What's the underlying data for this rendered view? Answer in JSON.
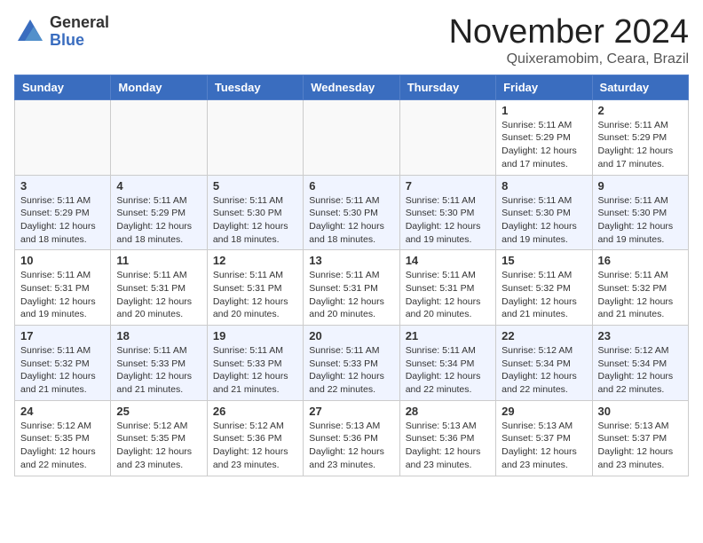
{
  "header": {
    "logo_general": "General",
    "logo_blue": "Blue",
    "month_title": "November 2024",
    "location": "Quixeramobim, Ceara, Brazil"
  },
  "weekdays": [
    "Sunday",
    "Monday",
    "Tuesday",
    "Wednesday",
    "Thursday",
    "Friday",
    "Saturday"
  ],
  "weeks": [
    [
      {
        "day": "",
        "info": ""
      },
      {
        "day": "",
        "info": ""
      },
      {
        "day": "",
        "info": ""
      },
      {
        "day": "",
        "info": ""
      },
      {
        "day": "",
        "info": ""
      },
      {
        "day": "1",
        "info": "Sunrise: 5:11 AM\nSunset: 5:29 PM\nDaylight: 12 hours\nand 17 minutes."
      },
      {
        "day": "2",
        "info": "Sunrise: 5:11 AM\nSunset: 5:29 PM\nDaylight: 12 hours\nand 17 minutes."
      }
    ],
    [
      {
        "day": "3",
        "info": "Sunrise: 5:11 AM\nSunset: 5:29 PM\nDaylight: 12 hours\nand 18 minutes."
      },
      {
        "day": "4",
        "info": "Sunrise: 5:11 AM\nSunset: 5:29 PM\nDaylight: 12 hours\nand 18 minutes."
      },
      {
        "day": "5",
        "info": "Sunrise: 5:11 AM\nSunset: 5:30 PM\nDaylight: 12 hours\nand 18 minutes."
      },
      {
        "day": "6",
        "info": "Sunrise: 5:11 AM\nSunset: 5:30 PM\nDaylight: 12 hours\nand 18 minutes."
      },
      {
        "day": "7",
        "info": "Sunrise: 5:11 AM\nSunset: 5:30 PM\nDaylight: 12 hours\nand 19 minutes."
      },
      {
        "day": "8",
        "info": "Sunrise: 5:11 AM\nSunset: 5:30 PM\nDaylight: 12 hours\nand 19 minutes."
      },
      {
        "day": "9",
        "info": "Sunrise: 5:11 AM\nSunset: 5:30 PM\nDaylight: 12 hours\nand 19 minutes."
      }
    ],
    [
      {
        "day": "10",
        "info": "Sunrise: 5:11 AM\nSunset: 5:31 PM\nDaylight: 12 hours\nand 19 minutes."
      },
      {
        "day": "11",
        "info": "Sunrise: 5:11 AM\nSunset: 5:31 PM\nDaylight: 12 hours\nand 20 minutes."
      },
      {
        "day": "12",
        "info": "Sunrise: 5:11 AM\nSunset: 5:31 PM\nDaylight: 12 hours\nand 20 minutes."
      },
      {
        "day": "13",
        "info": "Sunrise: 5:11 AM\nSunset: 5:31 PM\nDaylight: 12 hours\nand 20 minutes."
      },
      {
        "day": "14",
        "info": "Sunrise: 5:11 AM\nSunset: 5:31 PM\nDaylight: 12 hours\nand 20 minutes."
      },
      {
        "day": "15",
        "info": "Sunrise: 5:11 AM\nSunset: 5:32 PM\nDaylight: 12 hours\nand 21 minutes."
      },
      {
        "day": "16",
        "info": "Sunrise: 5:11 AM\nSunset: 5:32 PM\nDaylight: 12 hours\nand 21 minutes."
      }
    ],
    [
      {
        "day": "17",
        "info": "Sunrise: 5:11 AM\nSunset: 5:32 PM\nDaylight: 12 hours\nand 21 minutes."
      },
      {
        "day": "18",
        "info": "Sunrise: 5:11 AM\nSunset: 5:33 PM\nDaylight: 12 hours\nand 21 minutes."
      },
      {
        "day": "19",
        "info": "Sunrise: 5:11 AM\nSunset: 5:33 PM\nDaylight: 12 hours\nand 21 minutes."
      },
      {
        "day": "20",
        "info": "Sunrise: 5:11 AM\nSunset: 5:33 PM\nDaylight: 12 hours\nand 22 minutes."
      },
      {
        "day": "21",
        "info": "Sunrise: 5:11 AM\nSunset: 5:34 PM\nDaylight: 12 hours\nand 22 minutes."
      },
      {
        "day": "22",
        "info": "Sunrise: 5:12 AM\nSunset: 5:34 PM\nDaylight: 12 hours\nand 22 minutes."
      },
      {
        "day": "23",
        "info": "Sunrise: 5:12 AM\nSunset: 5:34 PM\nDaylight: 12 hours\nand 22 minutes."
      }
    ],
    [
      {
        "day": "24",
        "info": "Sunrise: 5:12 AM\nSunset: 5:35 PM\nDaylight: 12 hours\nand 22 minutes."
      },
      {
        "day": "25",
        "info": "Sunrise: 5:12 AM\nSunset: 5:35 PM\nDaylight: 12 hours\nand 23 minutes."
      },
      {
        "day": "26",
        "info": "Sunrise: 5:12 AM\nSunset: 5:36 PM\nDaylight: 12 hours\nand 23 minutes."
      },
      {
        "day": "27",
        "info": "Sunrise: 5:13 AM\nSunset: 5:36 PM\nDaylight: 12 hours\nand 23 minutes."
      },
      {
        "day": "28",
        "info": "Sunrise: 5:13 AM\nSunset: 5:36 PM\nDaylight: 12 hours\nand 23 minutes."
      },
      {
        "day": "29",
        "info": "Sunrise: 5:13 AM\nSunset: 5:37 PM\nDaylight: 12 hours\nand 23 minutes."
      },
      {
        "day": "30",
        "info": "Sunrise: 5:13 AM\nSunset: 5:37 PM\nDaylight: 12 hours\nand 23 minutes."
      }
    ]
  ]
}
